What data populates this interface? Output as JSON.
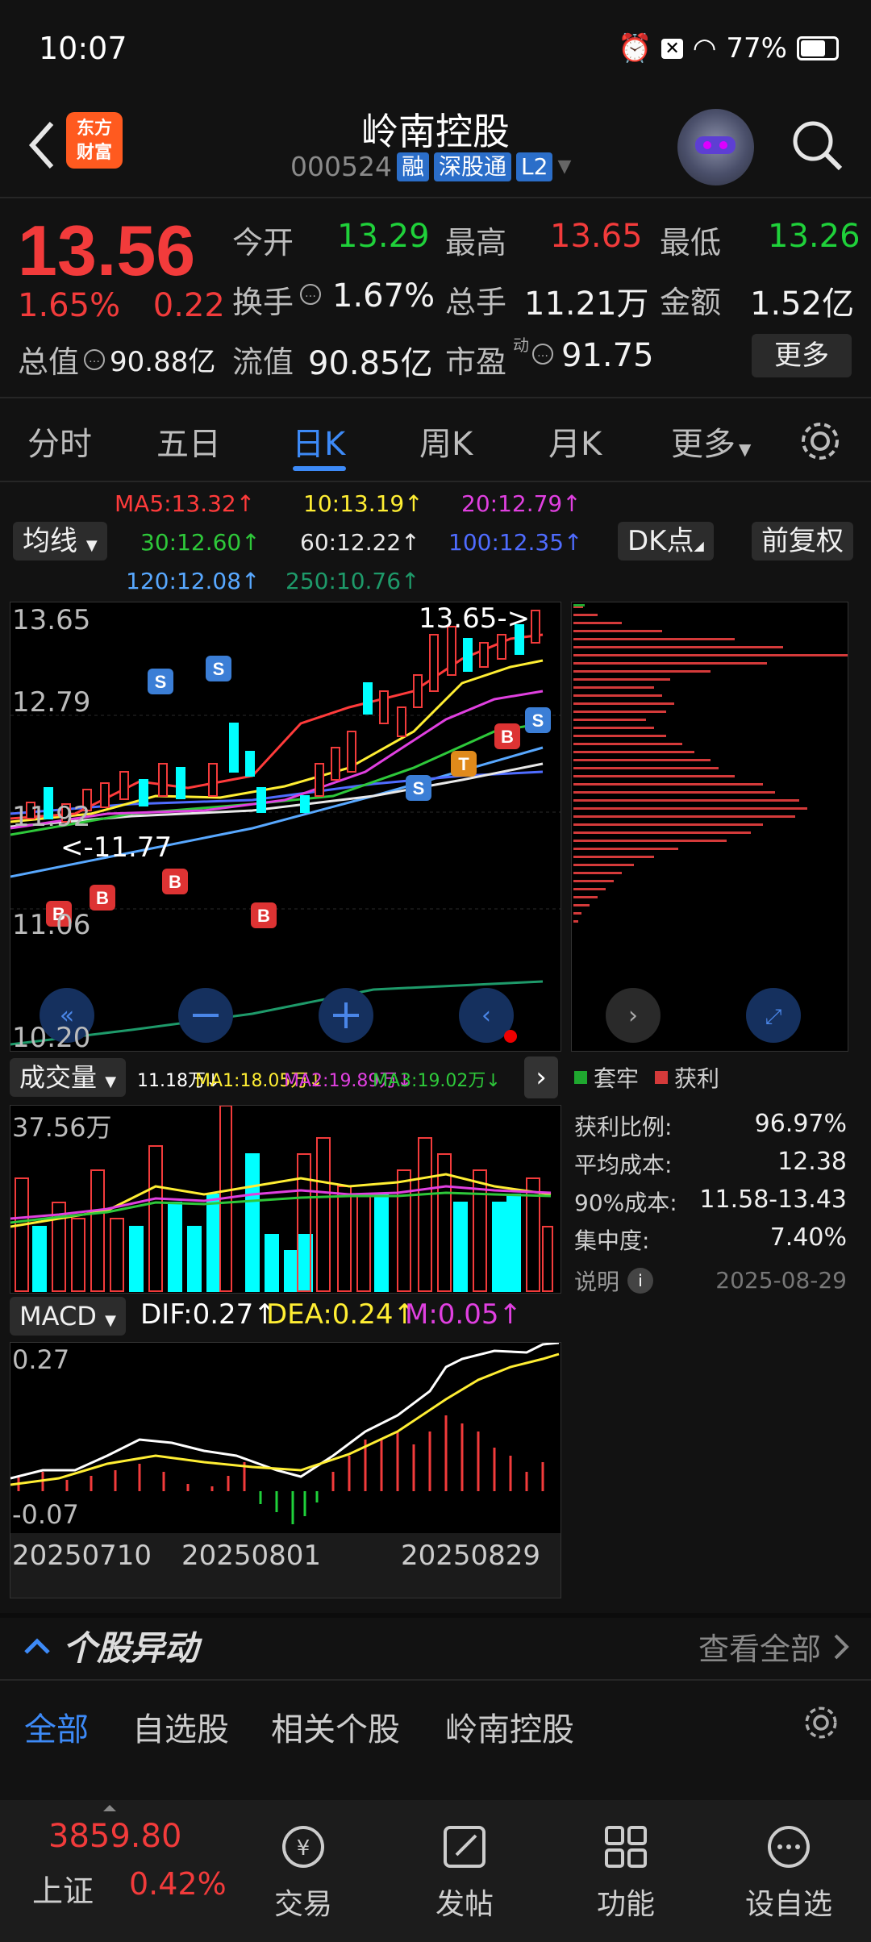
{
  "status_bar": {
    "time": "10:07",
    "battery": "77%",
    "battery_level": 0.77
  },
  "header": {
    "logo_line1": "东方",
    "logo_line2": "财富",
    "stock_name": "岭南控股",
    "stock_code": "000524",
    "tags": [
      "融",
      "深股通",
      "L2"
    ]
  },
  "quote": {
    "price": "13.56",
    "change_pct": "1.65%",
    "change": "0.22",
    "open_label": "今开",
    "open": "13.29",
    "high_label": "最高",
    "high": "13.65",
    "low_label": "最低",
    "low": "13.26",
    "turnover_label": "换手",
    "turnover": "1.67%",
    "volume_label": "总手",
    "volume": "11.21万",
    "amount_label": "金额",
    "amount": "1.52亿",
    "mktcap_label": "总值",
    "mktcap": "90.88亿",
    "float_label": "流值",
    "float": "90.85亿",
    "pe_label": "市盈",
    "pe_sup": "动",
    "pe": "91.75",
    "more": "更多"
  },
  "tabs": [
    "分时",
    "五日",
    "日K",
    "周K",
    "月K",
    "更多"
  ],
  "active_tab": "日K",
  "ma_row": {
    "ma_btn": "均线",
    "ma5": "MA5:13.32↑",
    "ma10": "10:13.19↑",
    "ma20": "20:12.79↑",
    "ma30": "30:12.60↑",
    "ma60": "60:12.22↑",
    "ma100": "100:12.35↑",
    "ma120": "120:12.08↑",
    "ma250": "250:10.76↑",
    "dk_btn": "DK点",
    "fq_btn": "前复权",
    "colors": {
      "ma5": "#ff3b3b",
      "ma10": "#ffee33",
      "ma20": "#e040e0",
      "ma30": "#2ec83a",
      "ma60": "#e8e8e8",
      "ma100": "#4f6cff",
      "ma120": "#58a8ff",
      "ma250": "#1e9a6a"
    }
  },
  "kline": {
    "y_top": "13.65",
    "y_2": "12.79",
    "y_3": "11.92",
    "y_4": "11.06",
    "y_bottom": "10.20",
    "high_marker": "13.65->",
    "low_marker": "<-11.77"
  },
  "chip_dist": {
    "legend_trap": "套牢",
    "legend_profit": "获利",
    "rows": [
      {
        "label": "获利比例:",
        "value": "96.97%"
      },
      {
        "label": "平均成本:",
        "value": "12.38"
      },
      {
        "label": "90%成本:",
        "value": "11.58-13.43"
      },
      {
        "label": "集中度:",
        "value": "7.40%"
      }
    ],
    "note": "说明",
    "date": "2025-08-29"
  },
  "volume": {
    "btn": "成交量",
    "vol": "11.18万↓",
    "ma1": "MA1:18.05万↓",
    "ma2": "MA2:19.89万↓",
    "ma3": "MA3:19.02万↓",
    "y_top": "37.56万"
  },
  "macd": {
    "btn": "MACD",
    "dif": "DIF:0.27↑",
    "dea": "DEA:0.24↑",
    "m": "M:0.05↑",
    "y_top": "0.27",
    "y_bottom": "-0.07",
    "dates": [
      "20250710",
      "20250801",
      "20250829"
    ]
  },
  "movement": {
    "title": "个股异动",
    "view_all": "查看全部",
    "tabs": [
      "全部",
      "自选股",
      "相关个股",
      "岭南控股"
    ]
  },
  "bottom": {
    "index_value": "3859.80",
    "index_name": "上证",
    "index_change": "0.42%",
    "nav": [
      "交易",
      "发帖",
      "功能",
      "设自选"
    ]
  }
}
